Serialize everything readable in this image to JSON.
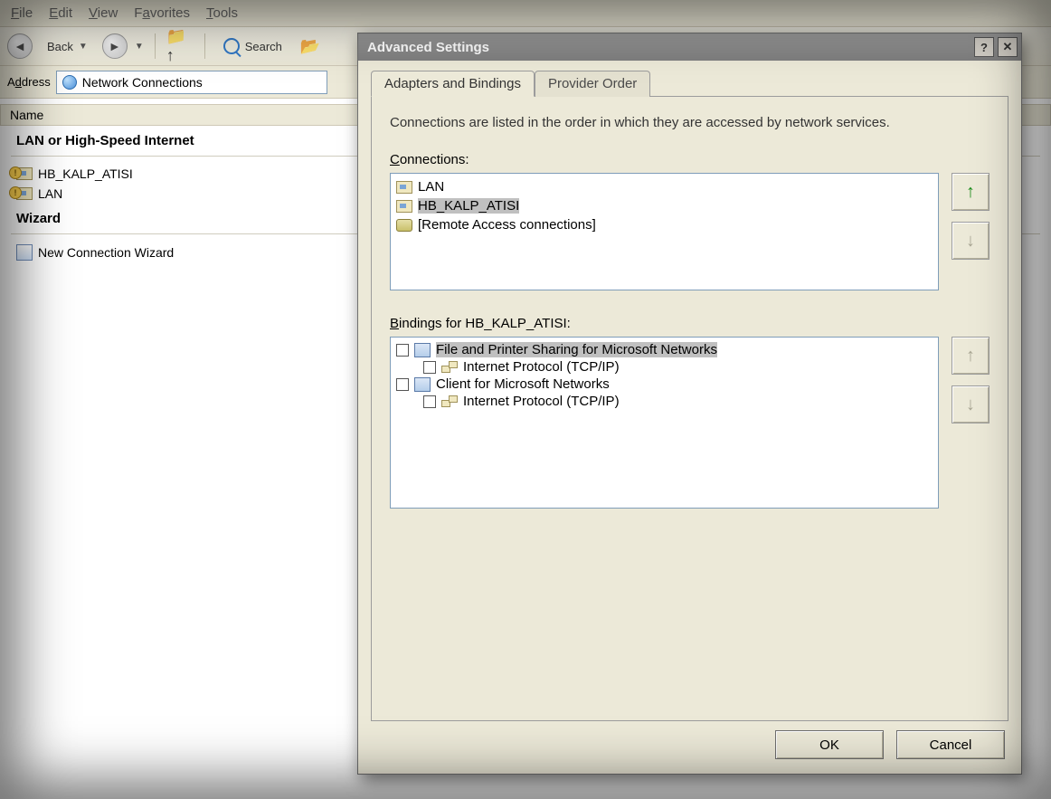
{
  "menubar": {
    "file": "File",
    "edit": "Edit",
    "view": "View",
    "favorites": "Favorites",
    "tools": "Tools"
  },
  "toolbar": {
    "back_label": "Back",
    "search_label": "Search"
  },
  "addressbar": {
    "label": "Address",
    "value": "Network Connections"
  },
  "explorer": {
    "column_name": "Name",
    "group_lan": "LAN or High-Speed Internet",
    "items_lan": [
      {
        "name": "HB_KALP_ATISI"
      },
      {
        "name": "LAN"
      }
    ],
    "group_wizard": "Wizard",
    "items_wizard": [
      {
        "name": "New Connection Wizard"
      }
    ]
  },
  "dialog": {
    "title": "Advanced Settings",
    "tabs": {
      "adapters": "Adapters and Bindings",
      "provider": "Provider Order"
    },
    "description": "Connections are listed in the order in which they are accessed by network services.",
    "connections_label": "Connections:",
    "connections": [
      {
        "name": "LAN",
        "selected": false
      },
      {
        "name": "HB_KALP_ATISI",
        "selected": true
      },
      {
        "name": "[Remote Access connections]",
        "selected": false,
        "type": "dialup"
      }
    ],
    "bindings_label": "Bindings for HB_KALP_ATISI:",
    "bindings": [
      {
        "name": "File and Printer Sharing for Microsoft Networks",
        "checked": false,
        "selected": true
      },
      {
        "name": "Internet Protocol (TCP/IP)",
        "checked": false,
        "indent": true
      },
      {
        "name": "Client for Microsoft Networks",
        "checked": false
      },
      {
        "name": "Internet Protocol (TCP/IP)",
        "checked": false,
        "indent": true
      }
    ],
    "buttons": {
      "ok": "OK",
      "cancel": "Cancel"
    }
  }
}
